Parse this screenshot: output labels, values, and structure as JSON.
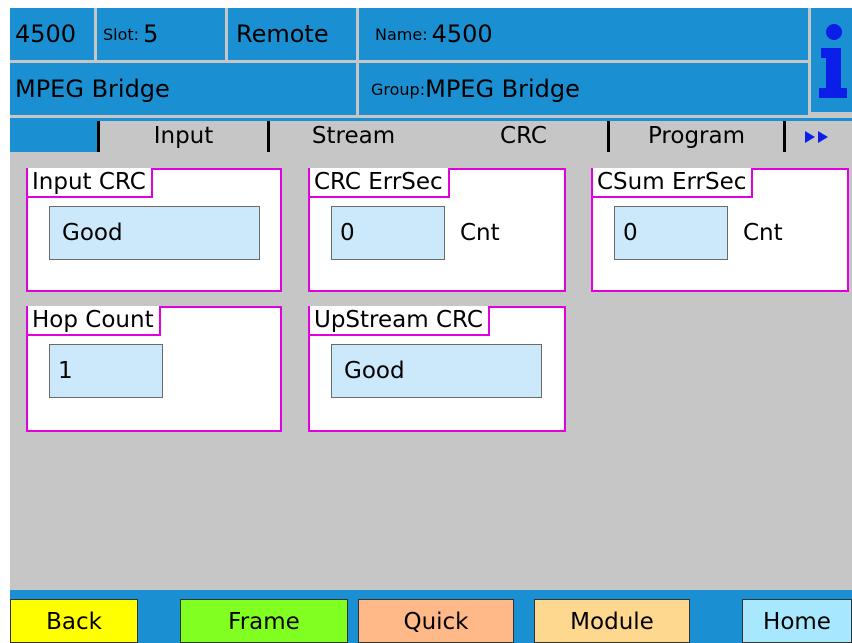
{
  "header": {
    "model": "4500",
    "slot_label": "Slot:",
    "slot_value": "5",
    "mode": "Remote",
    "name_label": "Name:",
    "name_value": "4500",
    "card": "MPEG Bridge",
    "group_label": "Group:",
    "group_value": "MPEG Bridge",
    "info_icon": "info-icon"
  },
  "tabs": [
    {
      "label": "Input",
      "active": false
    },
    {
      "label": "Stream",
      "active": false
    },
    {
      "label": "CRC",
      "active": true
    },
    {
      "label": "Program",
      "active": false
    }
  ],
  "tab_more_icon": "double-right-arrow-icon",
  "panels": {
    "input_crc": {
      "title": "Input CRC",
      "value": "Good"
    },
    "crc_errsec": {
      "title": "CRC ErrSec",
      "value": "0",
      "unit": "Cnt"
    },
    "csum_errsec": {
      "title": "CSum ErrSec",
      "value": "0",
      "unit": "Cnt"
    },
    "hop_count": {
      "title": "Hop Count",
      "value": "1"
    },
    "upstream_crc": {
      "title": "UpStream CRC",
      "value": "Good"
    }
  },
  "footer": {
    "back": "Back",
    "frame": "Frame",
    "quick": "Quick",
    "module": "Module",
    "home": "Home"
  },
  "colors": {
    "header_blue": "#1a8fd2",
    "panel_border": "#e000e0",
    "field_bg": "#cbe9fb",
    "back": "#ffff00",
    "frame": "#80ff20",
    "quick": "#ffb888",
    "module": "#ffd890",
    "home": "#a8e8ff"
  }
}
